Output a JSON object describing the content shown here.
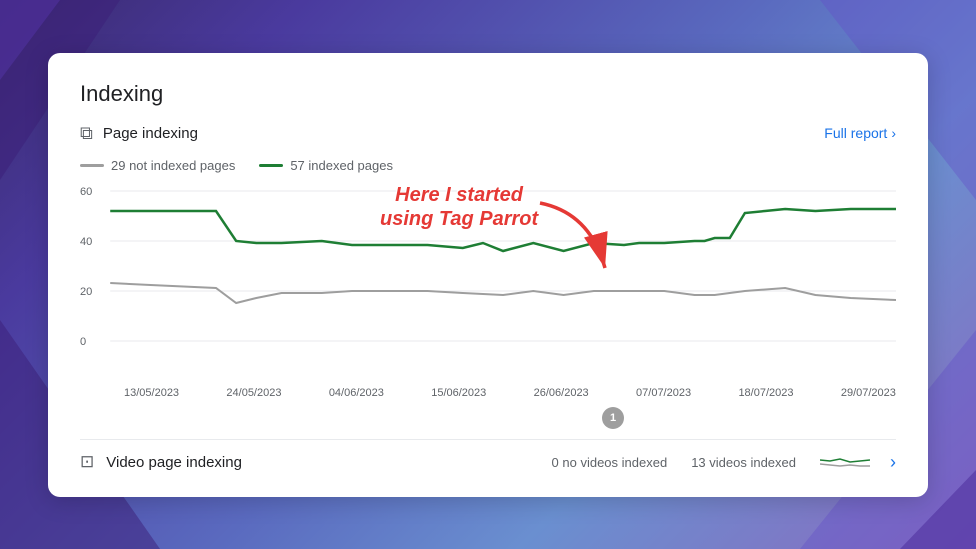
{
  "background": {
    "colors": [
      "#3a2a6e",
      "#4a3a9e",
      "#5a6abf",
      "#6a8fd0"
    ]
  },
  "card": {
    "title": "Indexing",
    "page_indexing": {
      "label": "Page indexing",
      "full_report": "Full report"
    },
    "legend": {
      "not_indexed": "29 not indexed pages",
      "indexed": "57 indexed pages"
    },
    "annotation": {
      "line1": "Here I started",
      "line2": "using Tag Parrot"
    },
    "chart": {
      "y_labels": [
        "60",
        "40",
        "20",
        "0"
      ],
      "x_labels": [
        "13/05/2023",
        "24/05/2023",
        "04/06/2023",
        "15/06/2023",
        "26/06/2023",
        "07/07/2023",
        "18/07/2023",
        "29/07/2023"
      ]
    },
    "page_marker": "1",
    "video_indexing": {
      "label": "Video page indexing",
      "stat1": "0 no videos indexed",
      "stat2": "13 videos indexed"
    }
  }
}
